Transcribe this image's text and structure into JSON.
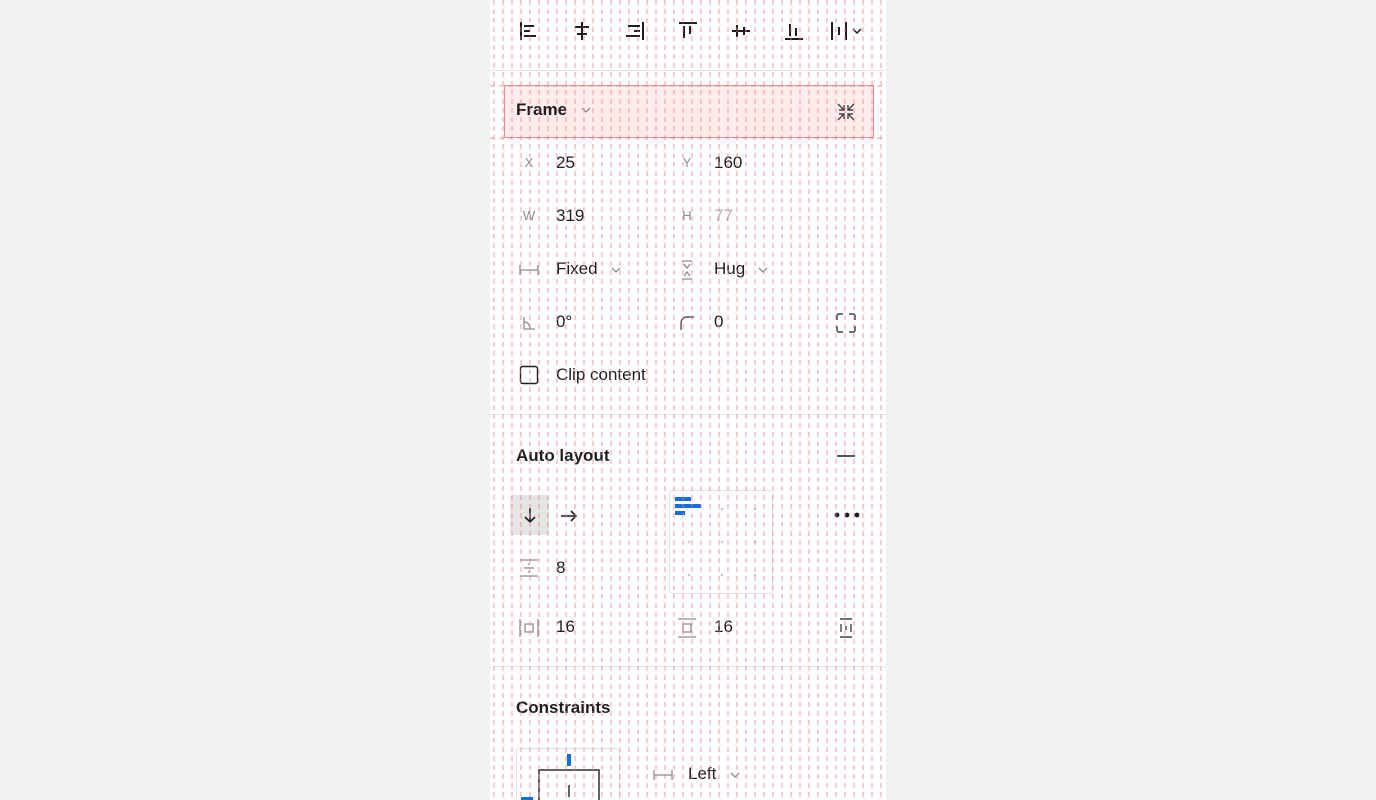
{
  "frame": {
    "title": "Frame",
    "x_label": "X",
    "x_value": "25",
    "y_label": "Y",
    "y_value": "160",
    "w_label": "W",
    "w_value": "319",
    "h_label": "H",
    "h_value": "77",
    "width_mode": "Fixed",
    "height_mode": "Hug",
    "rotation": "0°",
    "radius": "0",
    "clip_label": "Clip content"
  },
  "auto_layout": {
    "title": "Auto layout",
    "gap": "8",
    "padding_horizontal": "16",
    "padding_vertical": "16"
  },
  "constraints": {
    "title": "Constraints",
    "horizontal": "Left"
  },
  "colors": {
    "accent": "#0d6fe0",
    "grid_line": "#f07a7a",
    "highlight_border": "#f08a8a"
  }
}
